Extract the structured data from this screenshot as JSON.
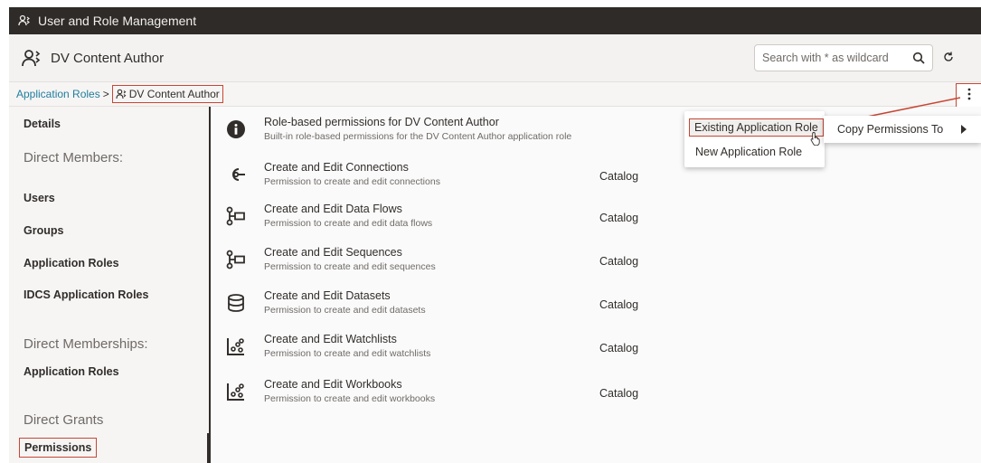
{
  "app": {
    "title": "User and Role Management"
  },
  "header": {
    "title": "DV Content Author",
    "search_placeholder": "Search with * as wildcard"
  },
  "breadcrumb": {
    "link": "Application Roles",
    "separator": ">",
    "current": "DV Content Author"
  },
  "sidebar": {
    "details": "Details",
    "direct_members_header": "Direct Members:",
    "users": "Users",
    "groups": "Groups",
    "application_roles": "Application Roles",
    "idcs_application_roles": "IDCS Application Roles",
    "direct_memberships_header": "Direct Memberships:",
    "memberships_application_roles": "Application Roles",
    "direct_grants_header": "Direct Grants",
    "permissions": "Permissions"
  },
  "permissions": [
    {
      "title": "Role-based permissions for DV Content Author",
      "desc": "Built-in role-based permissions for the DV Content Author application role",
      "category": "",
      "icon": "info-icon"
    },
    {
      "title": "Create and Edit Connections",
      "desc": "Permission to create and edit connections",
      "category": "Catalog",
      "icon": "connection-icon"
    },
    {
      "title": "Create and Edit Data Flows",
      "desc": "Permission to create and edit data flows",
      "category": "Catalog",
      "icon": "data-flow-icon"
    },
    {
      "title": "Create and Edit Sequences",
      "desc": "Permission to create and edit sequences",
      "category": "Catalog",
      "icon": "sequence-icon"
    },
    {
      "title": "Create and Edit Datasets",
      "desc": "Permission to create and edit datasets",
      "category": "Catalog",
      "icon": "dataset-icon"
    },
    {
      "title": "Create and Edit Watchlists",
      "desc": "Permission to create and edit watchlists",
      "category": "Catalog",
      "icon": "watchlist-icon"
    },
    {
      "title": "Create and Edit Workbooks",
      "desc": "Permission to create and edit workbooks",
      "category": "Catalog",
      "icon": "workbook-icon"
    }
  ],
  "menu": {
    "existing_role": "Existing Application Role",
    "new_role": "New Application Role",
    "copy_permissions": "Copy Permissions To"
  },
  "colors": {
    "highlight": "#c74634",
    "link": "#227e9e",
    "appbar": "#2e2b28"
  }
}
